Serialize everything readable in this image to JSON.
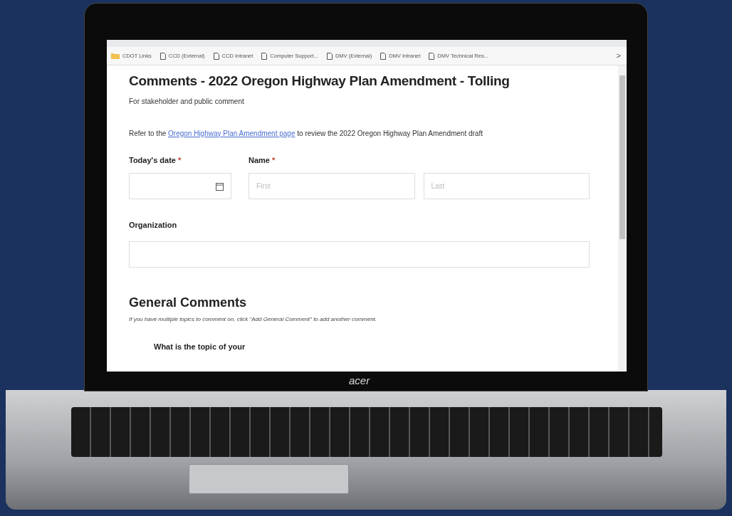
{
  "laptop": {
    "logo": "acer"
  },
  "browser": {
    "bookmarks": [
      {
        "kind": "folder",
        "label": "CDOT Links"
      },
      {
        "kind": "page",
        "label": "CCD (External)"
      },
      {
        "kind": "page",
        "label": "CCD Intranet"
      },
      {
        "kind": "page",
        "label": "Computer Support..."
      },
      {
        "kind": "page",
        "label": "DMV (External)"
      },
      {
        "kind": "page",
        "label": "DMV Intranet"
      },
      {
        "kind": "page",
        "label": "DMV Technical Res..."
      }
    ],
    "more": ">"
  },
  "form": {
    "title": "Comments - 2022 Oregon Highway Plan Amendment - Tolling",
    "subtitle": "For stakeholder and public comment",
    "intro": {
      "before": "Refer to the",
      "link": "Oregon Highway Plan Amendment page",
      "after": "to review the 2022 Oregon Highway Plan Amendment draft"
    },
    "date": {
      "label": "Today's date",
      "required_mark": "*"
    },
    "name": {
      "label": "Name",
      "required_mark": "*",
      "first_placeholder": "First",
      "last_placeholder": "Last"
    },
    "organization": {
      "label": "Organization"
    },
    "section": {
      "title": "General Comments",
      "hint": "If you have multiple topics to comment on, click \"Add General Comment\" to add another comment."
    },
    "question": "What is the topic of your"
  }
}
